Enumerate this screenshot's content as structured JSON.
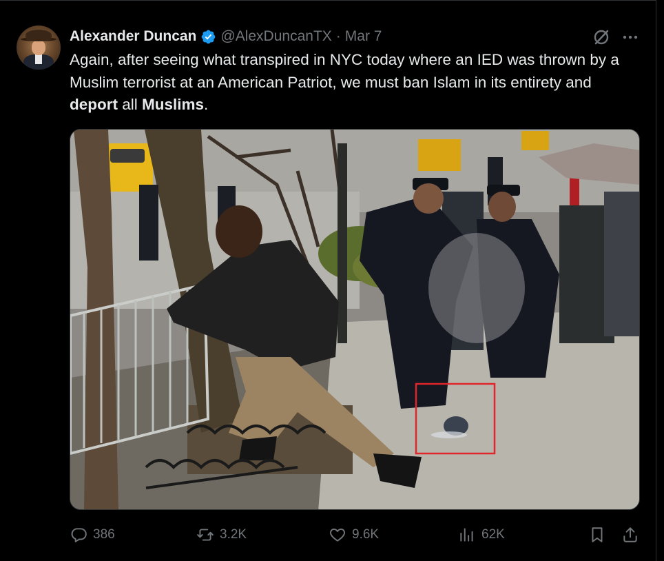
{
  "author": {
    "name": "Alexander Duncan",
    "handle": "@AlexDuncanTX",
    "separator": "·",
    "date": "Mar 7",
    "verified": true
  },
  "tweet": {
    "text_part1": "Again, after seeing what transpired in NYC today where an IED was thrown by a Muslim terrorist at an American Patriot, we must ban Islam in its entirety and ",
    "bold1": "deport",
    "text_part2": " all ",
    "bold2": "Muslims",
    "text_part3": "."
  },
  "media": {
    "highlight_color": "#e0252b"
  },
  "actions": {
    "replies": "386",
    "reposts": "3.2K",
    "likes": "9.6K",
    "views": "62K"
  },
  "icons": {
    "verified": "verified-badge-icon",
    "grok": "grok-icon",
    "more": "more-icon",
    "reply": "reply-icon",
    "repost": "repost-icon",
    "like": "heart-icon",
    "views": "views-icon",
    "bookmark": "bookmark-icon",
    "share": "share-icon"
  },
  "colors": {
    "background": "#000000",
    "text": "#e7e9ea",
    "secondary": "#71767b",
    "verified": "#1d9bf0"
  }
}
